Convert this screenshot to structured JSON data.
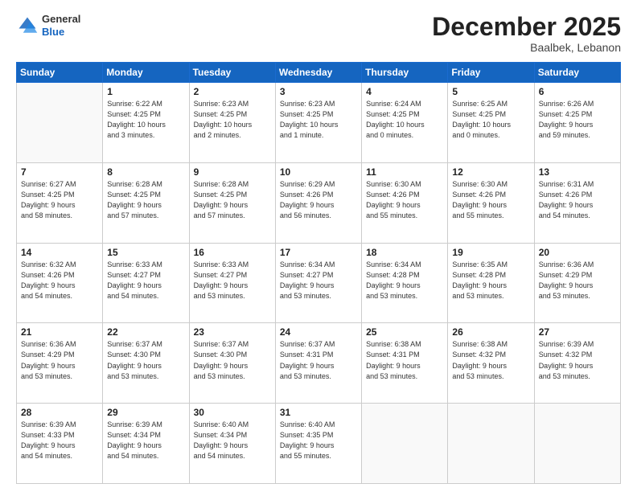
{
  "header": {
    "logo_general": "General",
    "logo_blue": "Blue",
    "month": "December 2025",
    "location": "Baalbek, Lebanon"
  },
  "days_of_week": [
    "Sunday",
    "Monday",
    "Tuesday",
    "Wednesday",
    "Thursday",
    "Friday",
    "Saturday"
  ],
  "weeks": [
    [
      {
        "day": "",
        "info": ""
      },
      {
        "day": "1",
        "info": "Sunrise: 6:22 AM\nSunset: 4:25 PM\nDaylight: 10 hours\nand 3 minutes."
      },
      {
        "day": "2",
        "info": "Sunrise: 6:23 AM\nSunset: 4:25 PM\nDaylight: 10 hours\nand 2 minutes."
      },
      {
        "day": "3",
        "info": "Sunrise: 6:23 AM\nSunset: 4:25 PM\nDaylight: 10 hours\nand 1 minute."
      },
      {
        "day": "4",
        "info": "Sunrise: 6:24 AM\nSunset: 4:25 PM\nDaylight: 10 hours\nand 0 minutes."
      },
      {
        "day": "5",
        "info": "Sunrise: 6:25 AM\nSunset: 4:25 PM\nDaylight: 10 hours\nand 0 minutes."
      },
      {
        "day": "6",
        "info": "Sunrise: 6:26 AM\nSunset: 4:25 PM\nDaylight: 9 hours\nand 59 minutes."
      }
    ],
    [
      {
        "day": "7",
        "info": "Sunrise: 6:27 AM\nSunset: 4:25 PM\nDaylight: 9 hours\nand 58 minutes."
      },
      {
        "day": "8",
        "info": "Sunrise: 6:28 AM\nSunset: 4:25 PM\nDaylight: 9 hours\nand 57 minutes."
      },
      {
        "day": "9",
        "info": "Sunrise: 6:28 AM\nSunset: 4:25 PM\nDaylight: 9 hours\nand 57 minutes."
      },
      {
        "day": "10",
        "info": "Sunrise: 6:29 AM\nSunset: 4:26 PM\nDaylight: 9 hours\nand 56 minutes."
      },
      {
        "day": "11",
        "info": "Sunrise: 6:30 AM\nSunset: 4:26 PM\nDaylight: 9 hours\nand 55 minutes."
      },
      {
        "day": "12",
        "info": "Sunrise: 6:30 AM\nSunset: 4:26 PM\nDaylight: 9 hours\nand 55 minutes."
      },
      {
        "day": "13",
        "info": "Sunrise: 6:31 AM\nSunset: 4:26 PM\nDaylight: 9 hours\nand 54 minutes."
      }
    ],
    [
      {
        "day": "14",
        "info": "Sunrise: 6:32 AM\nSunset: 4:26 PM\nDaylight: 9 hours\nand 54 minutes."
      },
      {
        "day": "15",
        "info": "Sunrise: 6:33 AM\nSunset: 4:27 PM\nDaylight: 9 hours\nand 54 minutes."
      },
      {
        "day": "16",
        "info": "Sunrise: 6:33 AM\nSunset: 4:27 PM\nDaylight: 9 hours\nand 53 minutes."
      },
      {
        "day": "17",
        "info": "Sunrise: 6:34 AM\nSunset: 4:27 PM\nDaylight: 9 hours\nand 53 minutes."
      },
      {
        "day": "18",
        "info": "Sunrise: 6:34 AM\nSunset: 4:28 PM\nDaylight: 9 hours\nand 53 minutes."
      },
      {
        "day": "19",
        "info": "Sunrise: 6:35 AM\nSunset: 4:28 PM\nDaylight: 9 hours\nand 53 minutes."
      },
      {
        "day": "20",
        "info": "Sunrise: 6:36 AM\nSunset: 4:29 PM\nDaylight: 9 hours\nand 53 minutes."
      }
    ],
    [
      {
        "day": "21",
        "info": "Sunrise: 6:36 AM\nSunset: 4:29 PM\nDaylight: 9 hours\nand 53 minutes."
      },
      {
        "day": "22",
        "info": "Sunrise: 6:37 AM\nSunset: 4:30 PM\nDaylight: 9 hours\nand 53 minutes."
      },
      {
        "day": "23",
        "info": "Sunrise: 6:37 AM\nSunset: 4:30 PM\nDaylight: 9 hours\nand 53 minutes."
      },
      {
        "day": "24",
        "info": "Sunrise: 6:37 AM\nSunset: 4:31 PM\nDaylight: 9 hours\nand 53 minutes."
      },
      {
        "day": "25",
        "info": "Sunrise: 6:38 AM\nSunset: 4:31 PM\nDaylight: 9 hours\nand 53 minutes."
      },
      {
        "day": "26",
        "info": "Sunrise: 6:38 AM\nSunset: 4:32 PM\nDaylight: 9 hours\nand 53 minutes."
      },
      {
        "day": "27",
        "info": "Sunrise: 6:39 AM\nSunset: 4:32 PM\nDaylight: 9 hours\nand 53 minutes."
      }
    ],
    [
      {
        "day": "28",
        "info": "Sunrise: 6:39 AM\nSunset: 4:33 PM\nDaylight: 9 hours\nand 54 minutes."
      },
      {
        "day": "29",
        "info": "Sunrise: 6:39 AM\nSunset: 4:34 PM\nDaylight: 9 hours\nand 54 minutes."
      },
      {
        "day": "30",
        "info": "Sunrise: 6:40 AM\nSunset: 4:34 PM\nDaylight: 9 hours\nand 54 minutes."
      },
      {
        "day": "31",
        "info": "Sunrise: 6:40 AM\nSunset: 4:35 PM\nDaylight: 9 hours\nand 55 minutes."
      },
      {
        "day": "",
        "info": ""
      },
      {
        "day": "",
        "info": ""
      },
      {
        "day": "",
        "info": ""
      }
    ]
  ]
}
